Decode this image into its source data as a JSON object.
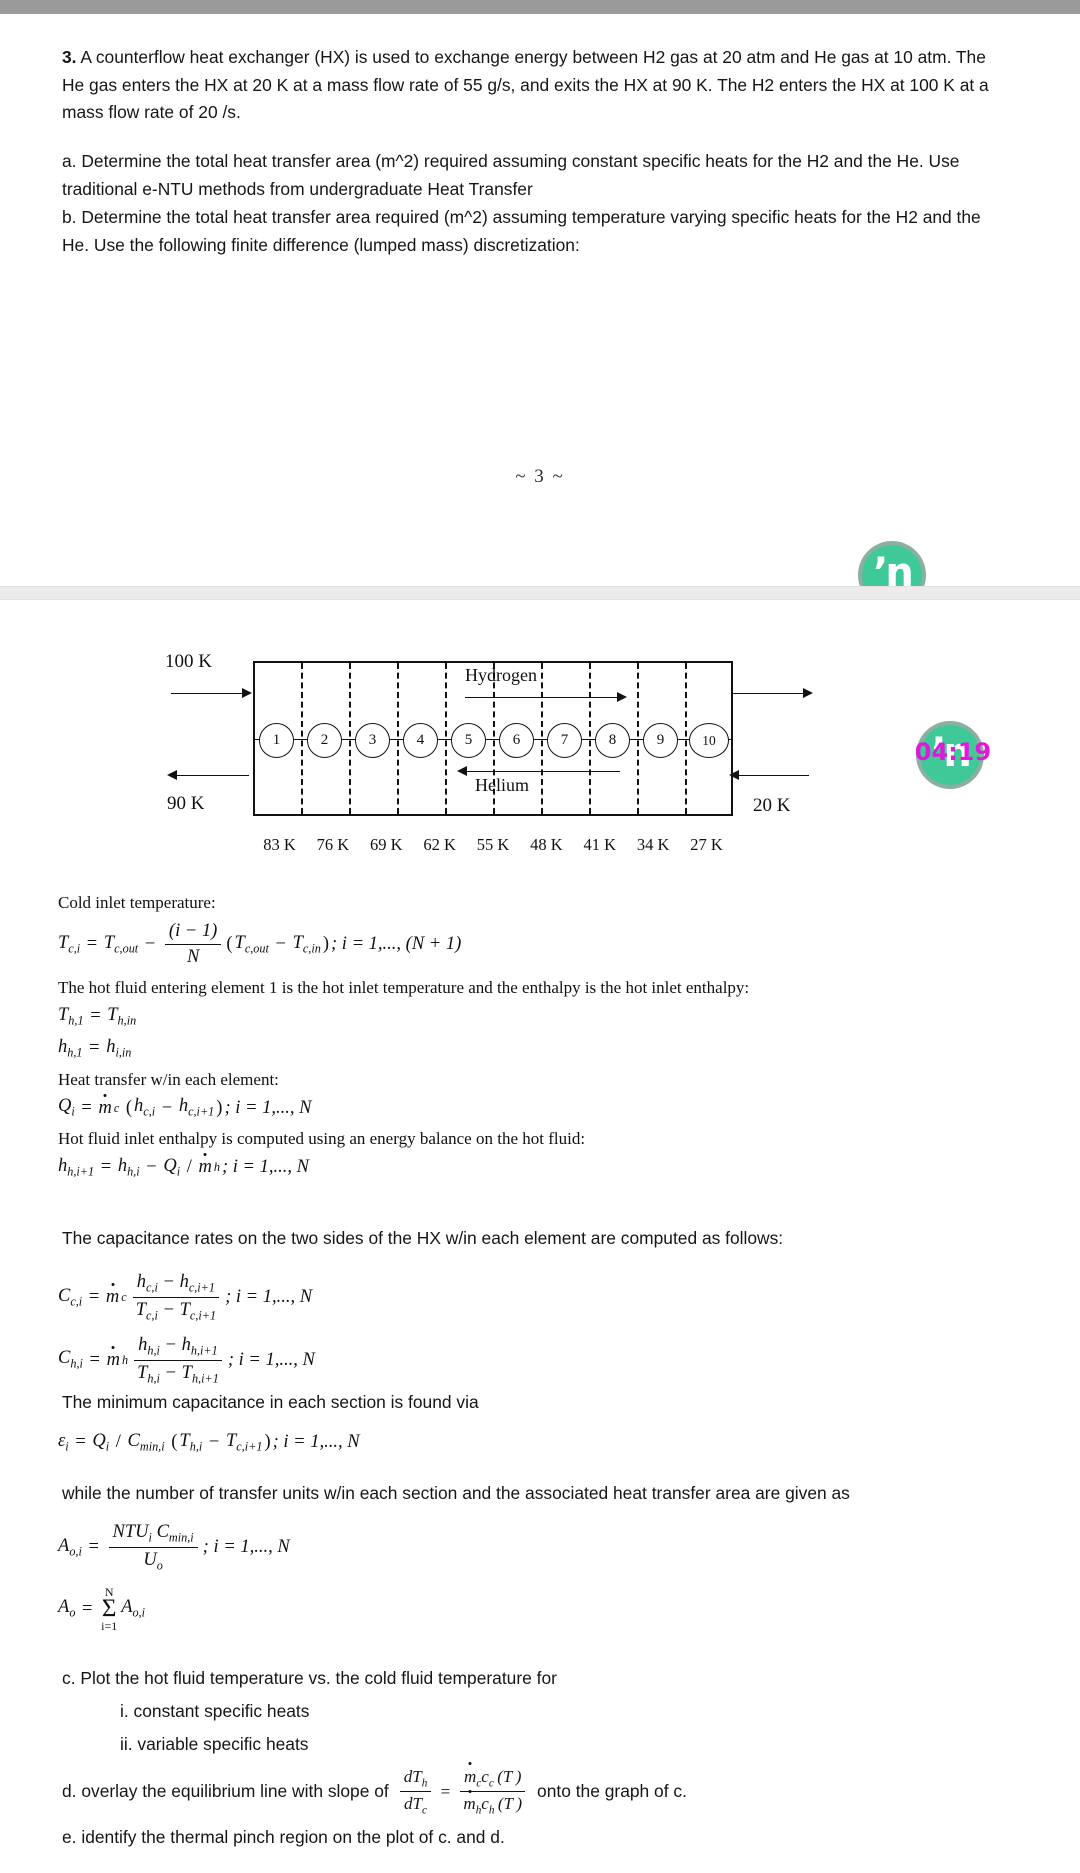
{
  "document": {
    "page_marker": "~ 3 ~",
    "problem_number": "3.",
    "paragraph_1": "A counterflow heat exchanger (HX) is used to exchange energy between H2 gas at 20 atm and He gas at 10 atm. The He gas enters the HX at 20 K at a mass flow rate of 55 g/s, and exits the HX at 90 K. The H2 enters the HX at 100 K at a mass flow rate of 20 /s.",
    "paragraph_a": "a. Determine the total heat transfer area (m^2) required assuming constant specific heats for the H2 and the He. Use traditional e-NTU methods from undergraduate Heat Transfer",
    "paragraph_b": "b. Determine the total heat transfer area required (m^2) assuming temperature varying specific heats for the H2 and the He. Use the following finite difference (lumped mass) discretization:"
  },
  "badges": {
    "logo_glyph": "ʼn",
    "timer_value": "04:19",
    "green": "#3fc998",
    "timer_color": "#e018d8"
  },
  "figure": {
    "hot_inlet_label": "100 K",
    "hot_outlet_label": "90 K",
    "cold_inlet_label": "20 K",
    "hot_stream_label": "Hydrogen",
    "cold_stream_label": "Helium",
    "nodes": [
      "1",
      "2",
      "3",
      "4",
      "5",
      "6",
      "7",
      "8",
      "9",
      "10"
    ],
    "interface_temperatures": [
      "83 K",
      "76 K",
      "69 K",
      "62 K",
      "55 K",
      "48 K",
      "41 K",
      "34 K",
      "27 K"
    ]
  },
  "equations": {
    "cold_inlet_heading": "Cold inlet temperature:",
    "hot_entering_text": "The hot fluid entering element 1 is the hot inlet temperature and the enthalpy is the hot inlet enthalpy:",
    "heat_transfer_heading": "Heat transfer w/in each element:",
    "energy_balance_heading": "Hot fluid inlet enthalpy is computed using an energy balance on the hot fluid:",
    "capacitance_text": "The capacitance rates on the two sides of the HX w/in each element are computed as follows:",
    "min_capacitance_text": "The minimum capacitance in each section is found via",
    "ntu_text": "while the number of transfer units w/in each section and the associated heat transfer area are given as",
    "range_N": "; i = 1,..., N",
    "range_N1": "; i = 1,..., (N + 1)"
  },
  "tasks": {
    "c": "c. Plot the hot fluid temperature vs. the cold fluid temperature for",
    "c_i": "i. constant specific heats",
    "c_ii": "ii. variable specific heats",
    "d_prefix": "d.  overlay the equilibrium line with slope of",
    "d_suffix": "onto the graph of c.",
    "e": "e. identify the thermal pinch region on the plot of c. and d."
  }
}
